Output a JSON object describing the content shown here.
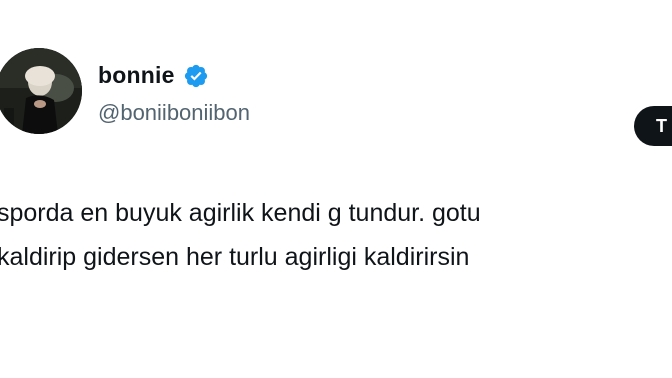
{
  "author": {
    "display_name": "bonnie",
    "handle": "@boniiboniibon",
    "verified": true,
    "avatar_icon": "profile-photo",
    "verified_icon": "verified-badge-icon",
    "verified_color": "#1d9bf0"
  },
  "follow_button": {
    "label": "T"
  },
  "tweet": {
    "lines": [
      "sporda en buyuk agirlik kendi g  tundur. gotu",
      "kaldirip gidersen her turlu agirligi kaldirirsin"
    ]
  },
  "colors": {
    "text": "#0f1419",
    "secondary_text": "#536471",
    "button_bg": "#0f1419",
    "background": "#ffffff"
  }
}
